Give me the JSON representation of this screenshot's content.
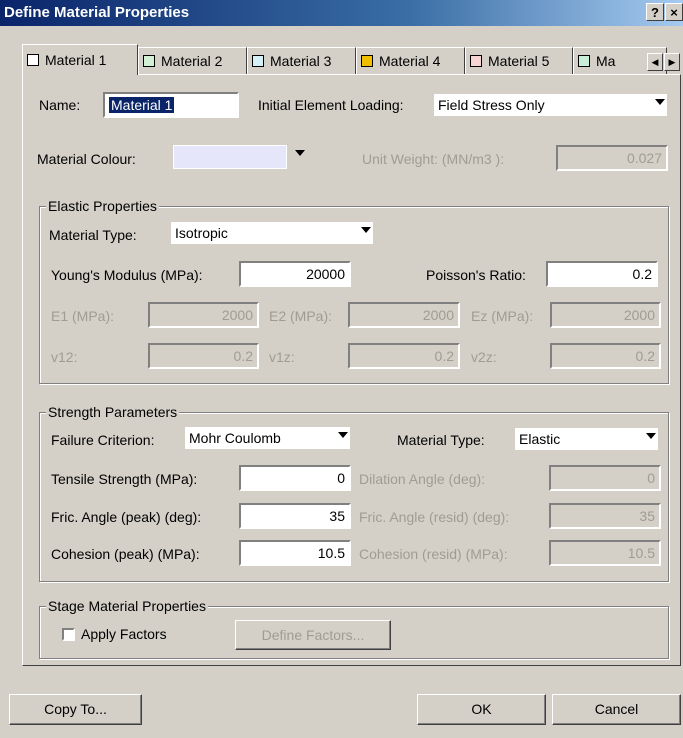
{
  "window": {
    "title": "Define Material Properties",
    "help": "?",
    "close": "×"
  },
  "tabs": [
    {
      "label": "Material 1",
      "color": "#ffffff"
    },
    {
      "label": "Material 2",
      "color": "#d4f0d4"
    },
    {
      "label": "Material 3",
      "color": "#d4f0f8"
    },
    {
      "label": "Material 4",
      "color": "#f0c000"
    },
    {
      "label": "Material 5",
      "color": "#f8d4d4"
    },
    {
      "label": "Ma",
      "color": "#c8f0d8"
    }
  ],
  "tab_scroll": {
    "left": "◀",
    "right": "▶"
  },
  "general": {
    "name_label": "Name:",
    "name_value": "Material 1",
    "loading_label": "Initial Element Loading:",
    "loading_value": "Field Stress Only",
    "colour_label": "Material Colour:",
    "colour_value": "#e6e6fa",
    "unit_weight_label": "Unit Weight: (MN/m3 ):",
    "unit_weight_value": "0.027"
  },
  "elastic": {
    "title": "Elastic Properties",
    "material_type_label": "Material Type:",
    "material_type_value": "Isotropic",
    "youngs_label": "Young's Modulus (MPa):",
    "youngs_value": "20000",
    "poisson_label": "Poisson's Ratio:",
    "poisson_value": "0.2",
    "e1_label": "E1 (MPa):",
    "e1_value": "2000",
    "e2_label": "E2 (MPa):",
    "e2_value": "2000",
    "ez_label": "Ez (MPa):",
    "ez_value": "2000",
    "v12_label": "v12:",
    "v12_value": "0.2",
    "v1z_label": "v1z:",
    "v1z_value": "0.2",
    "v2z_label": "v2z:",
    "v2z_value": "0.2"
  },
  "strength": {
    "title": "Strength Parameters",
    "failure_label": "Failure Criterion:",
    "failure_value": "Mohr Coulomb",
    "material_type_label": "Material Type:",
    "material_type_value": "Elastic",
    "tensile_label": "Tensile Strength (MPa):",
    "tensile_value": "0",
    "dilation_label": "Dilation Angle (deg):",
    "dilation_value": "0",
    "fric_peak_label": "Fric. Angle (peak) (deg):",
    "fric_peak_value": "35",
    "fric_resid_label": "Fric. Angle (resid) (deg):",
    "fric_resid_value": "35",
    "coh_peak_label": "Cohesion (peak) (MPa):",
    "coh_peak_value": "10.5",
    "coh_resid_label": "Cohesion (resid) (MPa):",
    "coh_resid_value": "10.5"
  },
  "stage": {
    "title": "Stage Material Properties",
    "apply_label": "Apply Factors",
    "define_label": "Define Factors..."
  },
  "footer": {
    "copy_label": "Copy To...",
    "ok_label": "OK",
    "cancel_label": "Cancel"
  }
}
